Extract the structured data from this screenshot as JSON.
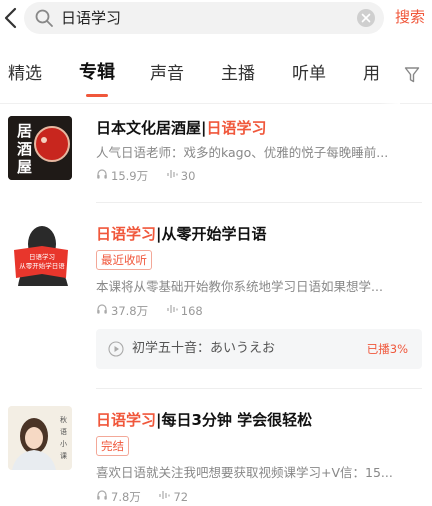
{
  "search": {
    "query": "日语学习",
    "button_label": "搜索"
  },
  "tabs": [
    {
      "label": "精选"
    },
    {
      "label": "专辑"
    },
    {
      "label": "声音"
    },
    {
      "label": "主播"
    },
    {
      "label": "听单"
    },
    {
      "label": "用"
    }
  ],
  "active_tab": "专辑",
  "highlight_color": "#f0573b",
  "results": [
    {
      "title_prefix": "日本文化居酒屋|",
      "title_highlight": "日语学习",
      "title_suffix": "",
      "cover_text": "居\n酒\n屋",
      "description": "人气日语老师：戏多的kago、优雅的悦子每晚睡前...",
      "plays": "15.9万",
      "tracks": "30"
    },
    {
      "title_prefix": "",
      "title_highlight": "日语学习",
      "title_suffix": "|从零开始学日语",
      "badge": "最近收听",
      "cover_text_1": "日语学习",
      "cover_text_2": "从零开始学日语",
      "description": "本课将从零基础开始教你系统地学习日语如果想学...",
      "plays": "37.8万",
      "tracks": "168",
      "recent_track": {
        "title": "初学五十音：あいうえお",
        "progress": "已播3%"
      }
    },
    {
      "title_prefix": "",
      "title_highlight": "日语学习",
      "title_suffix": "|每日3分钟 学会很轻松",
      "badge": "完结",
      "description": "喜欢日语就关注我吧想要获取视频课学习+V信：15...",
      "plays": "7.8万",
      "tracks": "72"
    }
  ]
}
